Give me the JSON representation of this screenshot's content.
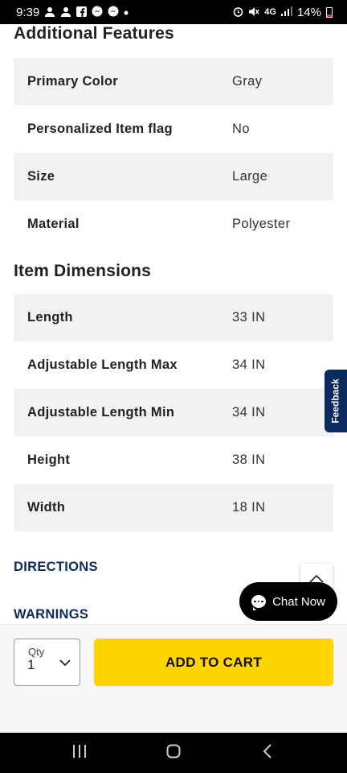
{
  "status_bar": {
    "time": "9:39",
    "left_icons": [
      "person-icon",
      "person-icon",
      "facebook-icon",
      "messenger-icon",
      "messenger-icon",
      "dot-icon"
    ],
    "right_icons": [
      "alarm-icon",
      "mute-icon",
      "4g-icon",
      "signal-icon"
    ],
    "network": "4G",
    "battery": "14%"
  },
  "additional_features": {
    "title": "Additional Features",
    "rows": [
      {
        "label": "Primary Color",
        "value": "Gray"
      },
      {
        "label": "Personalized Item flag",
        "value": "No"
      },
      {
        "label": "Size",
        "value": "Large"
      },
      {
        "label": "Material",
        "value": "Polyester"
      }
    ]
  },
  "item_dimensions": {
    "title": "Item Dimensions",
    "rows": [
      {
        "label": "Length",
        "value": "33 IN"
      },
      {
        "label": "Adjustable Length Max",
        "value": "34 IN"
      },
      {
        "label": "Adjustable Length Min",
        "value": "34 IN"
      },
      {
        "label": "Height",
        "value": "38 IN"
      },
      {
        "label": "Width",
        "value": "18 IN"
      }
    ]
  },
  "accordions": {
    "directions": "DIRECTIONS",
    "warnings": "WARNINGS"
  },
  "feedback": {
    "label": "Feedback"
  },
  "chat": {
    "label": "Chat Now"
  },
  "cart_bar": {
    "qty_label": "Qty",
    "qty_value": "1",
    "add_to_cart": "ADD TO CART"
  },
  "colors": {
    "accent_yellow": "#ffd500",
    "navy": "#0b2a5e",
    "row_alt": "#f2f2f2"
  }
}
